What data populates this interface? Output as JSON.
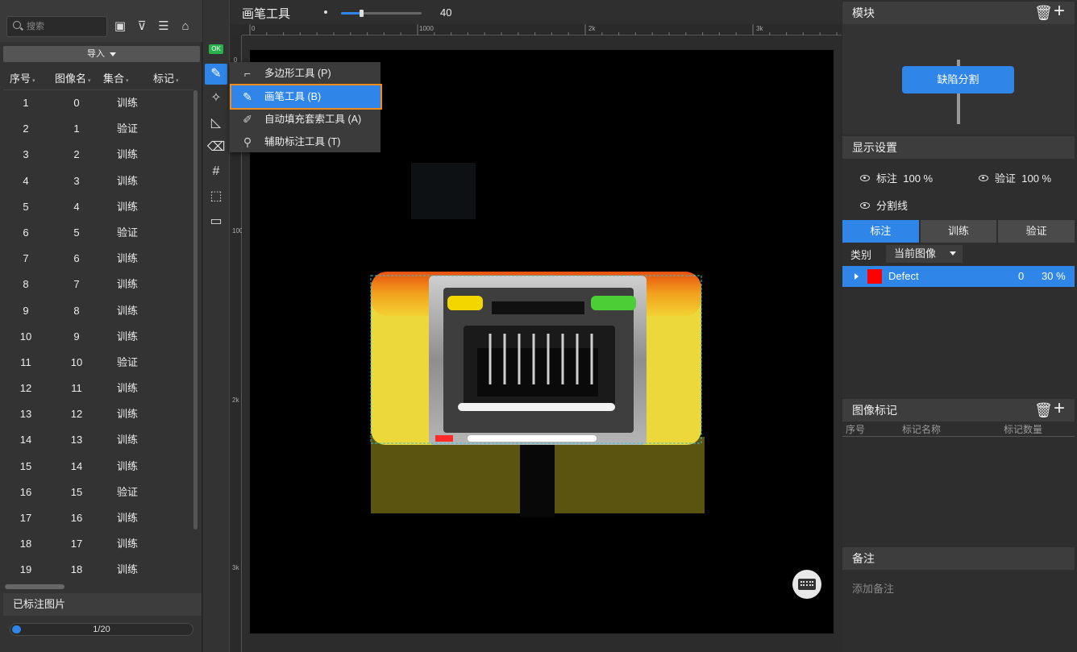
{
  "left_panel": {
    "search_placeholder": "搜索",
    "import_label": "导入",
    "columns": [
      "序号",
      "图像名",
      "集合",
      "标记"
    ],
    "rows": [
      {
        "idx": "1",
        "name": "0",
        "set": "训练"
      },
      {
        "idx": "2",
        "name": "1",
        "set": "验证"
      },
      {
        "idx": "3",
        "name": "2",
        "set": "训练"
      },
      {
        "idx": "4",
        "name": "3",
        "set": "训练"
      },
      {
        "idx": "5",
        "name": "4",
        "set": "训练"
      },
      {
        "idx": "6",
        "name": "5",
        "set": "验证"
      },
      {
        "idx": "7",
        "name": "6",
        "set": "训练"
      },
      {
        "idx": "8",
        "name": "7",
        "set": "训练"
      },
      {
        "idx": "9",
        "name": "8",
        "set": "训练"
      },
      {
        "idx": "10",
        "name": "9",
        "set": "训练"
      },
      {
        "idx": "11",
        "name": "10",
        "set": "验证"
      },
      {
        "idx": "12",
        "name": "11",
        "set": "训练"
      },
      {
        "idx": "13",
        "name": "12",
        "set": "训练"
      },
      {
        "idx": "14",
        "name": "13",
        "set": "训练"
      },
      {
        "idx": "15",
        "name": "14",
        "set": "训练"
      },
      {
        "idx": "16",
        "name": "15",
        "set": "验证"
      },
      {
        "idx": "17",
        "name": "16",
        "set": "训练"
      },
      {
        "idx": "18",
        "name": "17",
        "set": "训练"
      },
      {
        "idx": "19",
        "name": "18",
        "set": "训练"
      }
    ],
    "labeled_section": "已标注图片",
    "progress_text": "1/20",
    "progress_fraction": 0.05
  },
  "toolbar": {
    "ok_badge": "OK",
    "tool_title": "画笔工具",
    "brush_size": "40",
    "brush_fraction": 0.25
  },
  "ruler": {
    "h_labels": [
      "0",
      "1000",
      "2k",
      "3k"
    ],
    "v_labels": [
      "0",
      "1000",
      "2k",
      "3k"
    ]
  },
  "tool_menu": {
    "items": [
      {
        "label": "多边形工具 (P)",
        "icon": "polygon-icon"
      },
      {
        "label": "画笔工具 (B)",
        "icon": "brush-icon"
      },
      {
        "label": "自动填充套索工具 (A)",
        "icon": "lasso-icon"
      },
      {
        "label": "辅助标注工具 (T)",
        "icon": "assist-icon"
      }
    ],
    "selected_index": 1
  },
  "right_panel": {
    "module_title": "模块",
    "module_node": "缺陷分割",
    "display_title": "显示设置",
    "label_text": "标注",
    "label_pct": "100 %",
    "verify_text": "验证",
    "verify_pct": "100 %",
    "divider_text": "分割线",
    "tabs": [
      "标注",
      "训练",
      "验证"
    ],
    "active_tab": 0,
    "category_label": "类别",
    "category_select": "当前图像",
    "defect_name": "Defect",
    "defect_count": "0",
    "defect_pct": "30 %",
    "defect_color": "#ff0000",
    "image_marks_title": "图像标记",
    "marks_columns": [
      "序号",
      "标记名称",
      "标记数量"
    ],
    "notes_title": "备注",
    "notes_placeholder": "添加备注"
  },
  "colors": {
    "accent": "#2f86e8",
    "highlight_outline": "#f08c1e",
    "ok_green": "#27b24a"
  }
}
